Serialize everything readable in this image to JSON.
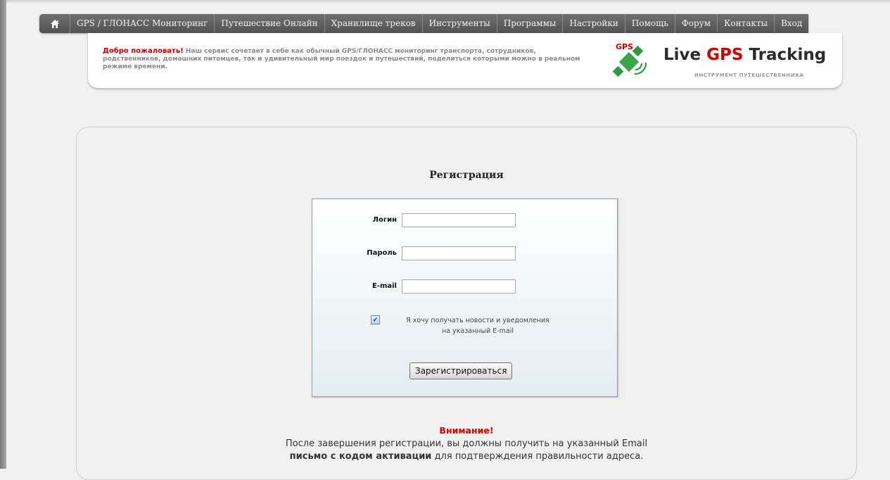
{
  "nav": {
    "items": [
      "GPS / ГЛОНАСС Мониторинг",
      "Путешествие Онлайн",
      "Хранилище треков",
      "Инструменты",
      "Программы",
      "Настройки",
      "Помощь",
      "Форум",
      "Контакты",
      "Вход"
    ]
  },
  "header": {
    "welcome_bold": "Добро пожаловать!",
    "welcome_text": "Наш сервис сочетает в себе как обычный GPS/ГЛОНАСС мониторинг транспорта, сотрудников, родственников, домашних питомцев, так и удивительный мир поездок и путешествий, поделиться которыми можно в реальном режиме времени.",
    "logo_badge": "GPS",
    "logo_live": "Live",
    "logo_gps": "GPS",
    "logo_tracking": "Tracking",
    "tagline": "ИНСТРУМЕНТ ПУТЕШЕСТВЕННИКА"
  },
  "registration": {
    "title": "Регистрация",
    "login_label": "Логин",
    "password_label": "Пароль",
    "email_label": "E-mail",
    "login_value": "",
    "password_value": "",
    "email_value": "",
    "newsletter_line1": "Я хочу получать новости и уведомления",
    "newsletter_line2": "на указанный E-mail",
    "submit_label": "Зарегистрироваться"
  },
  "notice": {
    "title": "Внимание!",
    "line1": "После завершения регистрации, вы должны получить на указанный Email",
    "line2_bold": "письмо с кодом активации",
    "line2_rest": "для подтверждения правильности адреса."
  },
  "colors": {
    "accent_red": "#d00000",
    "logo_green": "#2d9a3f",
    "nav_bg": "#5e5e5e"
  }
}
